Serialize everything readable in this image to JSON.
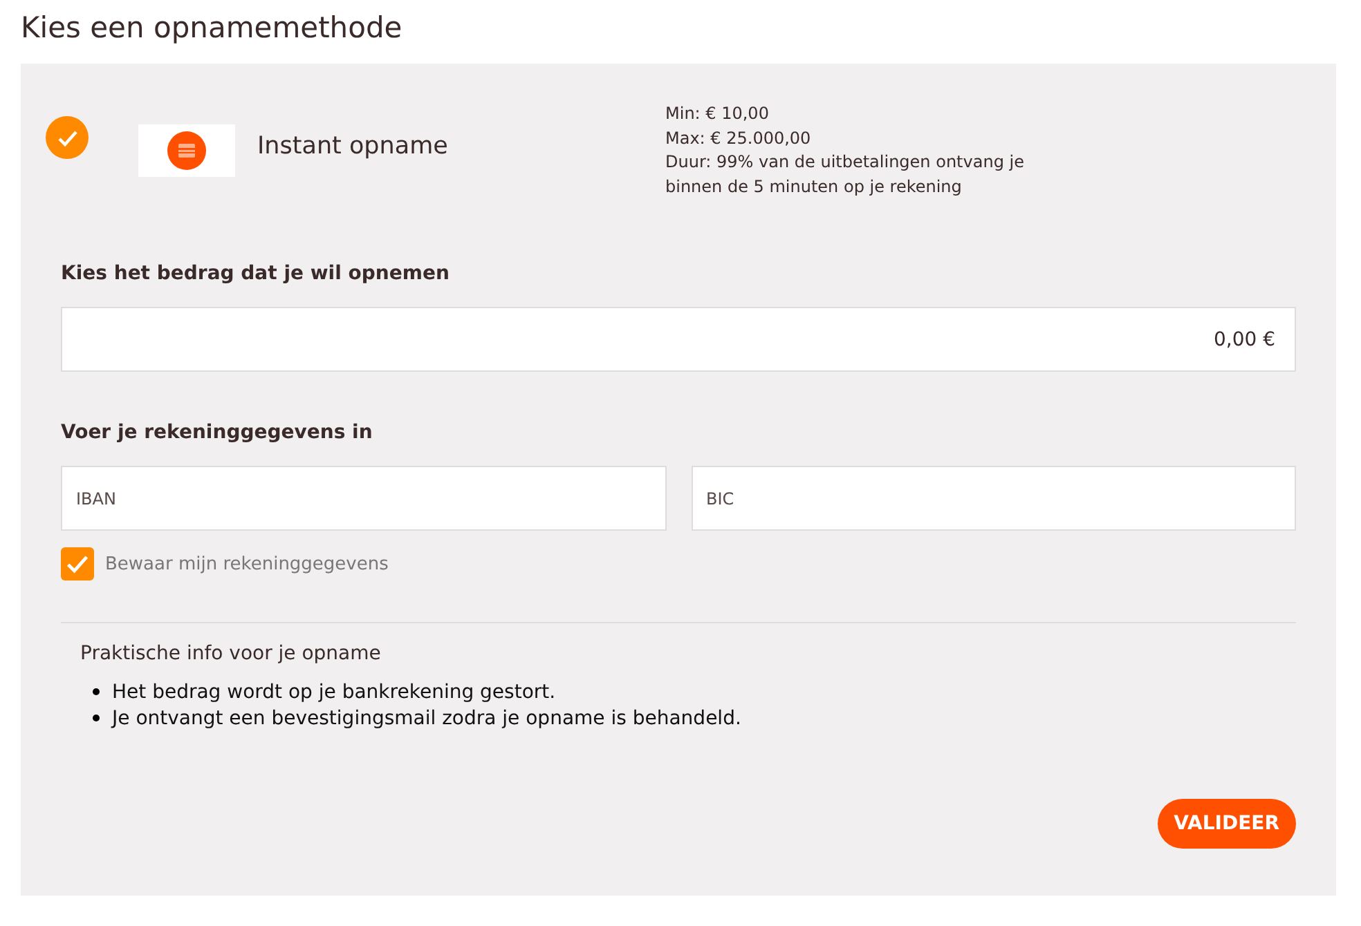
{
  "title": "Kies een opnamemethode",
  "method": {
    "selected": true,
    "name": "Instant opname",
    "info": [
      "Min: € 10,00",
      "Max: € 25.000,00",
      "Duur: 99% van de uitbetalingen ontvang je binnen de 5 minuten op je rekening"
    ]
  },
  "amount": {
    "label": "Kies het bedrag dat je wil opnemen",
    "value": "0,00 €"
  },
  "account": {
    "label": "Voer je rekeninggegevens in",
    "fields": [
      {
        "placeholder": "IBAN"
      },
      {
        "placeholder": "BIC"
      }
    ],
    "save": {
      "label": "Bewaar mijn rekeninggegevens",
      "checked": true
    }
  },
  "practical": {
    "title": "Praktische info voor je opname",
    "items": [
      "Het bedrag wordt op je bankrekening gestort.",
      "Je ontvangt een bevestigingsmail zodra je opname is behandeld."
    ]
  },
  "button": "VALIDEER"
}
